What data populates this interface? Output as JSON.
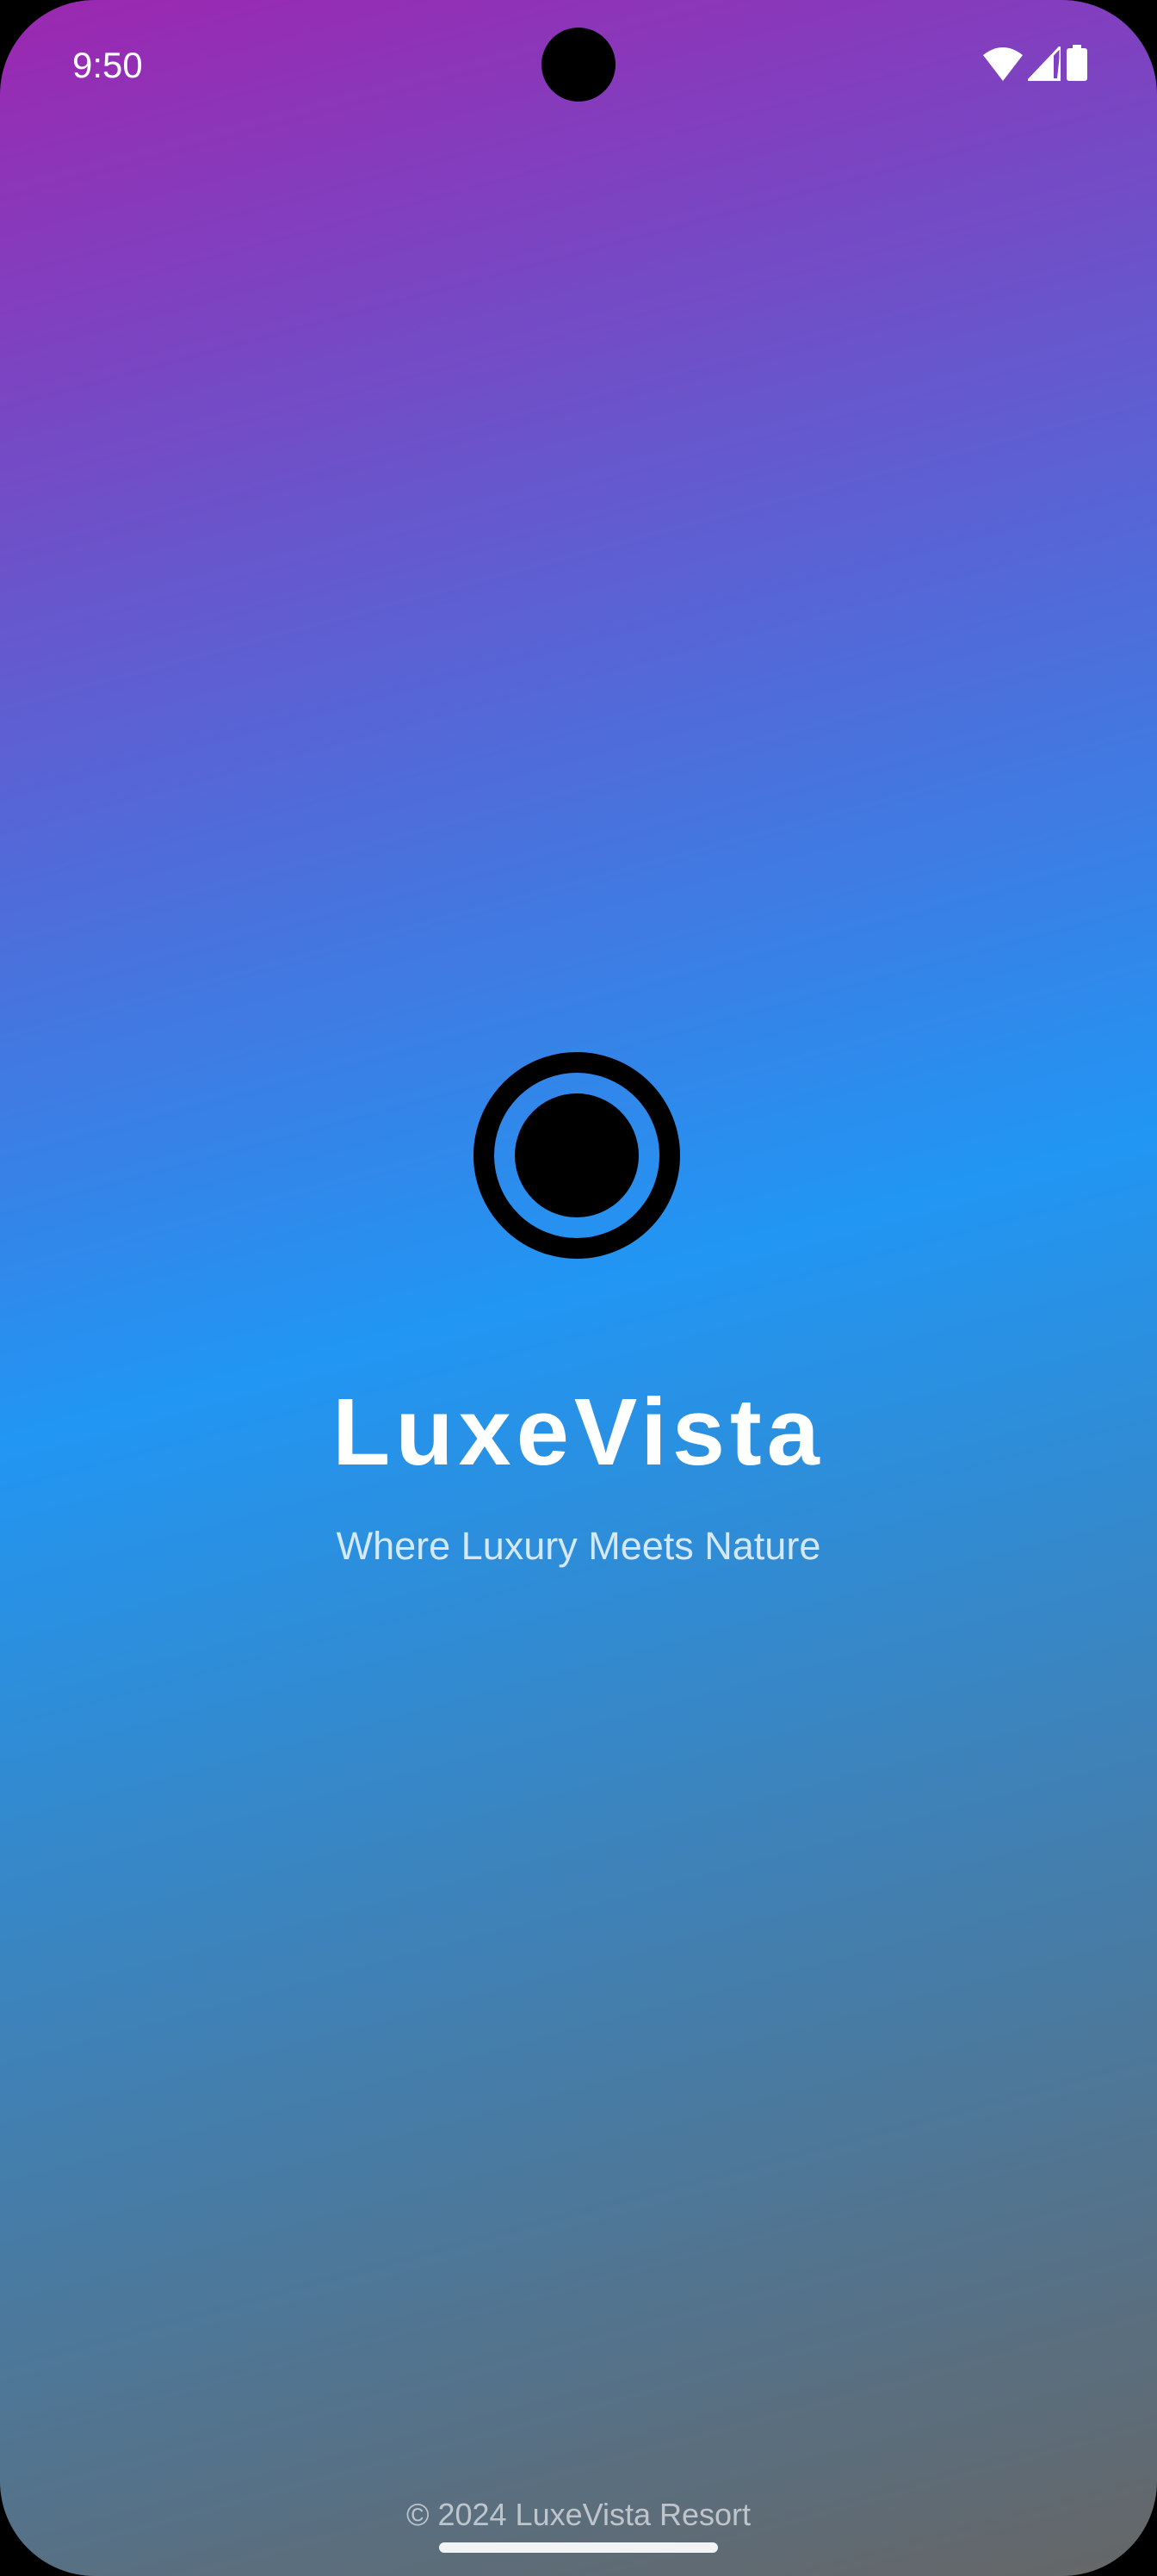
{
  "status_bar": {
    "time": "9:50",
    "icons": [
      "wifi-icon",
      "signal-icon",
      "battery-icon"
    ]
  },
  "splash": {
    "logo_icon": "radio-button-checked-icon",
    "title": "LuxeVista",
    "subtitle": "Where Luxury Meets Nature",
    "footer": "© 2024 LuxeVista Resort"
  },
  "colors": {
    "gradient_start": "#9c27b0",
    "gradient_mid": "#2196f3",
    "gradient_end": "#666666",
    "logo": "#000000",
    "text": "#ffffff"
  }
}
